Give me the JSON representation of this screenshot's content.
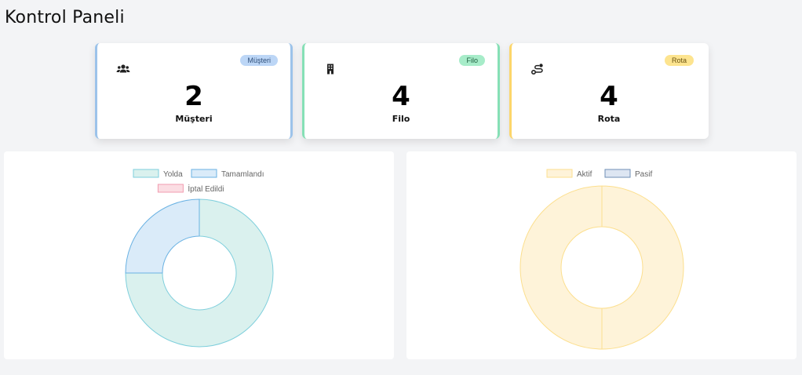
{
  "page": {
    "title": "Kontrol Paneli"
  },
  "cards": [
    {
      "badge": "Müşteri",
      "value": "2",
      "label": "Müşteri",
      "icon": "users-icon",
      "accent": "#9cc3ea"
    },
    {
      "badge": "Filo",
      "value": "4",
      "label": "Filo",
      "icon": "building-icon",
      "accent": "#86e0b6"
    },
    {
      "badge": "Rota",
      "value": "4",
      "label": "Rota",
      "icon": "route-icon",
      "accent": "#fcd66b"
    }
  ],
  "chart_data": [
    {
      "type": "doughnut",
      "legend": [
        "Yolda",
        "Tamamlandı",
        "İptal Edildi"
      ],
      "legend_position": "top",
      "values": [
        3,
        1,
        0
      ],
      "colors": {
        "fill": [
          "#daf1ee",
          "#daebf9",
          "#fbdde3"
        ],
        "stroke": [
          "#7fcfdc",
          "#6ab2e3",
          "#f19db0"
        ]
      }
    },
    {
      "type": "doughnut",
      "legend": [
        "Aktif",
        "Pasif"
      ],
      "legend_position": "top",
      "values": [
        1,
        0
      ],
      "colors": {
        "fill": [
          "#fef3d9",
          "#dde6f2"
        ],
        "stroke": [
          "#fcdf8e",
          "#6f8fb5"
        ]
      }
    }
  ]
}
